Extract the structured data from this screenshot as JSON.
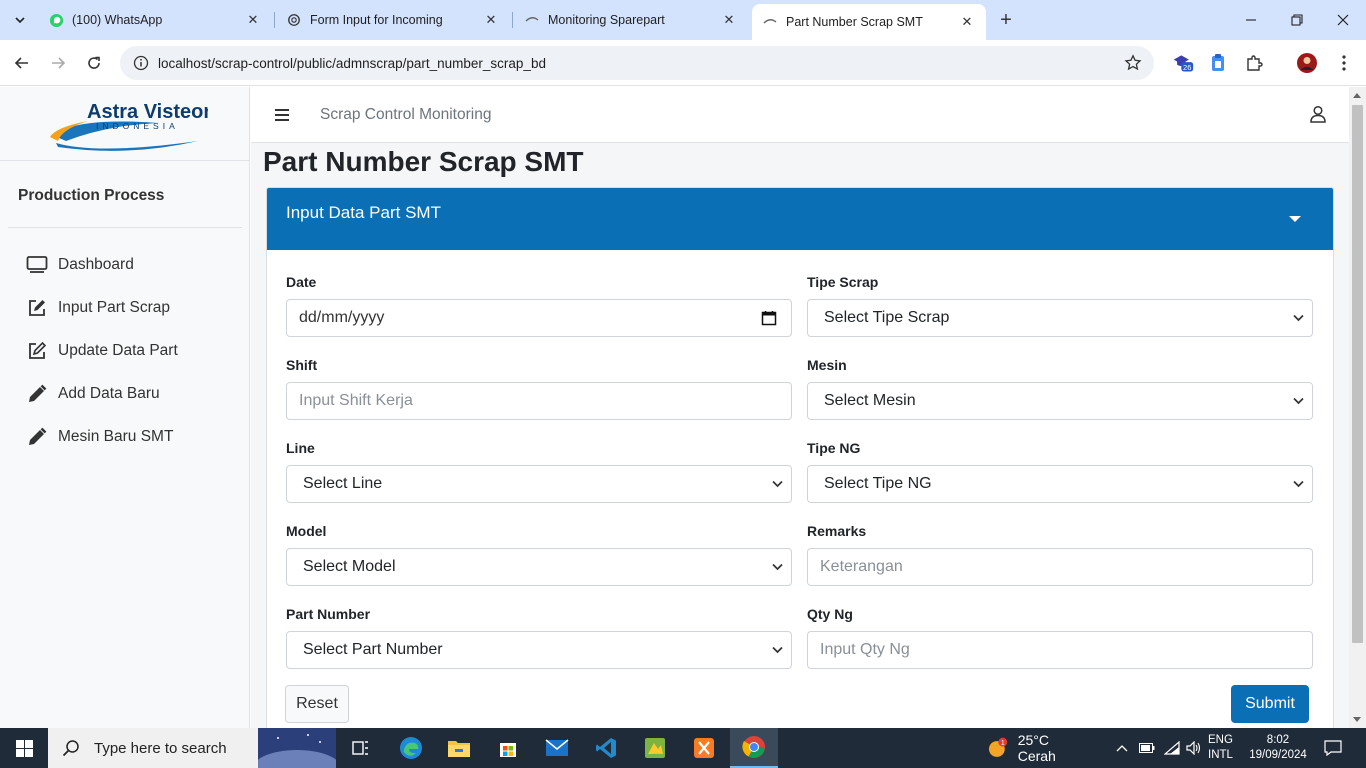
{
  "browser": {
    "tabs": [
      {
        "title": "(100) WhatsApp",
        "icon": "whatsapp-icon"
      },
      {
        "title": "Form Input for Incoming",
        "icon": "openai-icon"
      },
      {
        "title": "Monitoring Sparepart",
        "icon": "page-icon"
      },
      {
        "title": "Part Number Scrap SMT",
        "icon": "page-icon",
        "active": true
      }
    ],
    "url": "localhost/scrap-control/public/admnscrap/part_number_scrap_bd",
    "extension_badge": "26"
  },
  "brand": {
    "name": "Astra Visteon",
    "sub": "INDONESIA"
  },
  "sidebar": {
    "section_title": "Production Process",
    "items": [
      {
        "label": "Dashboard",
        "icon": "monitor-icon"
      },
      {
        "label": "Input Part Scrap",
        "icon": "edit-icon"
      },
      {
        "label": "Update Data Part",
        "icon": "edit-outline-icon"
      },
      {
        "label": "Add Data Baru",
        "icon": "pencil-icon"
      },
      {
        "label": "Mesin Baru SMT",
        "icon": "pencil-icon"
      }
    ]
  },
  "topbar": {
    "title": "Scrap Control Monitoring"
  },
  "page": {
    "title": "Part Number Scrap SMT"
  },
  "form": {
    "header": "Input Data Part SMT",
    "fields": {
      "date": {
        "label": "Date",
        "placeholder": "dd/mm/yyyy"
      },
      "shift": {
        "label": "Shift",
        "placeholder": "Input Shift Kerja"
      },
      "line": {
        "label": "Line",
        "value": "Select Line"
      },
      "model": {
        "label": "Model",
        "value": "Select Model"
      },
      "part_number": {
        "label": "Part Number",
        "value": "Select Part Number"
      },
      "tipe_scrap": {
        "label": "Tipe Scrap",
        "value": "Select Tipe Scrap"
      },
      "mesin": {
        "label": "Mesin",
        "value": "Select Mesin"
      },
      "tipe_ng": {
        "label": "Tipe NG",
        "value": "Select Tipe NG"
      },
      "remarks": {
        "label": "Remarks",
        "placeholder": "Keterangan"
      },
      "qty_ng": {
        "label": "Qty Ng",
        "placeholder": "Input Qty Ng"
      }
    },
    "reset_label": "Reset",
    "submit_label": "Submit"
  },
  "taskbar": {
    "search_placeholder": "Type here to search",
    "weather": "25°C  Cerah",
    "weather_badge": "1",
    "lang_top": "ENG",
    "lang_bottom": "INTL",
    "time": "8:02",
    "date": "19/09/2024"
  },
  "colors": {
    "primary": "#0b6fb5",
    "sidebar_bg": "#f8f9fa",
    "chrome_tabbar": "#d3e3fd"
  }
}
